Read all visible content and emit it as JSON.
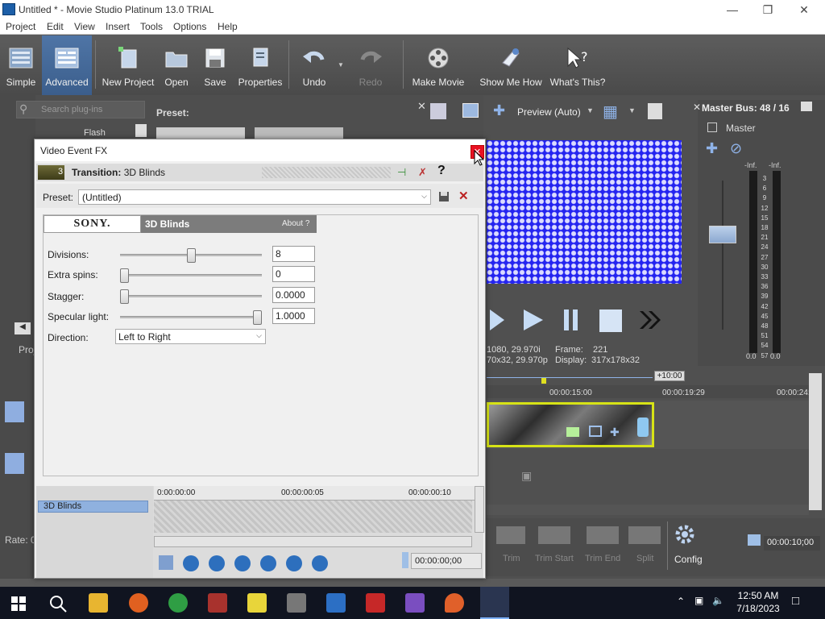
{
  "app": {
    "title": "Untitled * - Movie Studio Platinum 13.0 TRIAL"
  },
  "menu": [
    "Project",
    "Edit",
    "View",
    "Insert",
    "Tools",
    "Options",
    "Help"
  ],
  "toolbar": {
    "simple": "Simple",
    "advanced": "Advanced",
    "new_project": "New Project",
    "open": "Open",
    "save": "Save",
    "properties": "Properties",
    "undo": "Undo",
    "redo": "Redo",
    "make_movie": "Make Movie",
    "show_me_how": "Show Me How",
    "whats_this": "What's This?"
  },
  "left_panel": {
    "search_placeholder": "Search plug-ins",
    "preset_label": "Preset:",
    "flash": "Flash",
    "proj": "Proj",
    "rate": "Rate: 0"
  },
  "preview": {
    "mode": "Preview (Auto)",
    "info_line1": "1080, 29.970i",
    "info_line2": "70x32, 29.970p",
    "frame_label": "Frame:",
    "frame_value": "221",
    "display_label": "Display:",
    "display_value": "317x178x32"
  },
  "master_bus": {
    "title": "Master Bus: 48 / 16",
    "master": "Master",
    "inf_left": "-Inf.",
    "inf_right": "-Inf.",
    "scale": [
      "3",
      "6",
      "9",
      "12",
      "15",
      "18",
      "21",
      "24",
      "27",
      "30",
      "33",
      "36",
      "39",
      "42",
      "45",
      "48",
      "51",
      "54",
      "57"
    ],
    "bottom_left": "0.0",
    "bottom_right": "0.0"
  },
  "timeline": {
    "offset": "+10:00",
    "t1": "00:00:15:00",
    "t2": "00:00:19:29",
    "t3": "00:00:24:"
  },
  "bottom_tools": {
    "trim": "Trim",
    "trim_start": "Trim Start",
    "trim_end": "Trim End",
    "split": "Split",
    "config": "Config",
    "time": "00:00:10;00"
  },
  "dialog": {
    "title": "Video Event FX",
    "chain_num": "3",
    "transition_prefix": "Transition:",
    "transition_name": "3D Blinds",
    "help": "?",
    "preset_label": "Preset:",
    "preset_value": "(Untitled)",
    "sony": "SONY.",
    "plugin_name": "3D Blinds",
    "about": "About  ?",
    "params": {
      "divisions_label": "Divisions:",
      "divisions_value": "8",
      "divisions_frac": 0.5,
      "extra_spins_label": "Extra spins:",
      "extra_spins_value": "0",
      "extra_spins_frac": 0.0,
      "stagger_label": "Stagger:",
      "stagger_value": "0.0000",
      "stagger_frac": 0.0,
      "specular_label": "Specular light:",
      "specular_value": "1.0000",
      "specular_frac": 1.0,
      "direction_label": "Direction:",
      "direction_value": "Left to Right"
    },
    "keyframes": {
      "row_label": "3D Blinds",
      "r0": "0:00:00:00",
      "r1": "00:00:00:05",
      "r2": "00:00:00:10",
      "time": "00:00:00;00"
    }
  },
  "taskbar": {
    "time": "12:50 AM",
    "date": "7/18/2023"
  }
}
